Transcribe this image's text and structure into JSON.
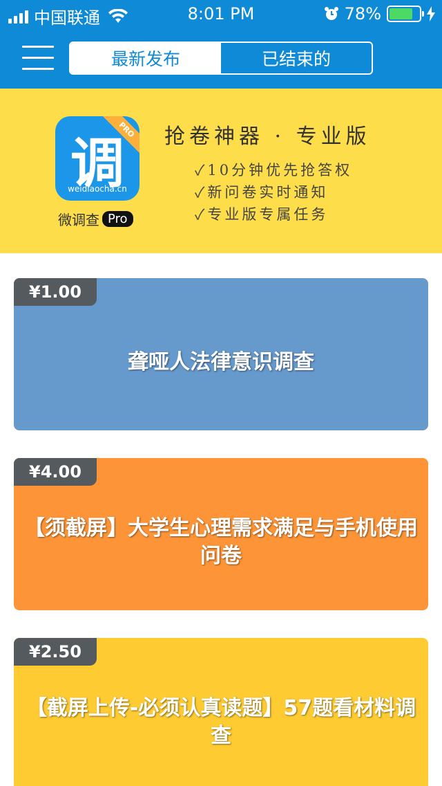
{
  "status_bar": {
    "carrier": "中国联通",
    "time": "8:01 PM",
    "battery": "78%",
    "battery_level": 0.78
  },
  "header": {
    "menu_icon": "hamburger-menu-icon",
    "tabs": [
      {
        "label": "最新发布",
        "active": true
      },
      {
        "label": "已结束的",
        "active": false
      }
    ]
  },
  "banner": {
    "app_icon_glyph": "调",
    "app_icon_url": "weidiaocha.cn",
    "app_icon_ribbon": "PRO",
    "app_name": "微调查",
    "app_badge": "Pro",
    "slogan_title": "抢卷神器 · 专业版",
    "slogan_items": [
      "✓10分钟优先抢答权",
      "✓新问卷实时通知",
      "✓专业版专属任务"
    ]
  },
  "surveys": [
    {
      "price": "¥1.00",
      "title": "聋哑人法律意识调查",
      "color": "#6699cc"
    },
    {
      "price": "¥4.00",
      "title": "【须截屏】大学生心理需求满足与手机使用问卷",
      "color": "#fd9538"
    },
    {
      "price": "¥2.50",
      "title": "【截屏上传-必须认真读题】57题看材料调查",
      "color": "#fecb32"
    }
  ],
  "colors": {
    "header_blue": "#0f8ad6",
    "banner_yellow": "#fddd4a",
    "price_tag": "#555a5e"
  }
}
